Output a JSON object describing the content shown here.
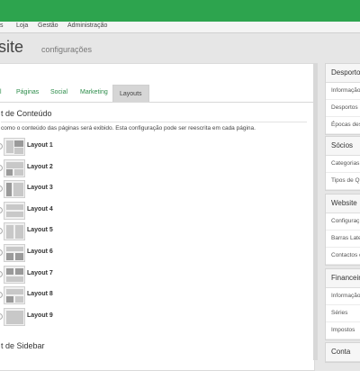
{
  "menu": [
    "s",
    "Loja",
    "Gestão",
    "Administração"
  ],
  "page": {
    "title": "site",
    "subtitle": "configurações"
  },
  "tabs": [
    "l",
    "Páginas",
    "Social",
    "Marketing",
    "Layouts"
  ],
  "content": {
    "section_title": "t de Conteúdo",
    "description": "como o conteúdo das páginas será exibido. Esta configuração pode ser reescrita em cada página.",
    "layouts": [
      "Layout 1",
      "Layout 2",
      "Layout 3",
      "Layout 4",
      "Layout 5",
      "Layout 6",
      "Layout 7",
      "Layout 8",
      "Layout 9"
    ],
    "sidebar_section_title": "t de Sidebar"
  },
  "sidebar": [
    {
      "title": "Desporto",
      "items": [
        "Informação",
        "Desportos",
        "Épocas des"
      ]
    },
    {
      "title": "Sócios",
      "items": [
        "Categorias",
        "Tipos de Q"
      ]
    },
    {
      "title": "Website",
      "items": [
        "Configuraç",
        "Barras Late",
        "Contactos d"
      ]
    },
    {
      "title": "Financeiro",
      "items": [
        "Informação",
        "Séries",
        "Impostos"
      ]
    },
    {
      "title": "Conta",
      "items": []
    }
  ],
  "colors": {
    "topbar": "#2da44e",
    "tab_link": "#2c8c4a"
  }
}
